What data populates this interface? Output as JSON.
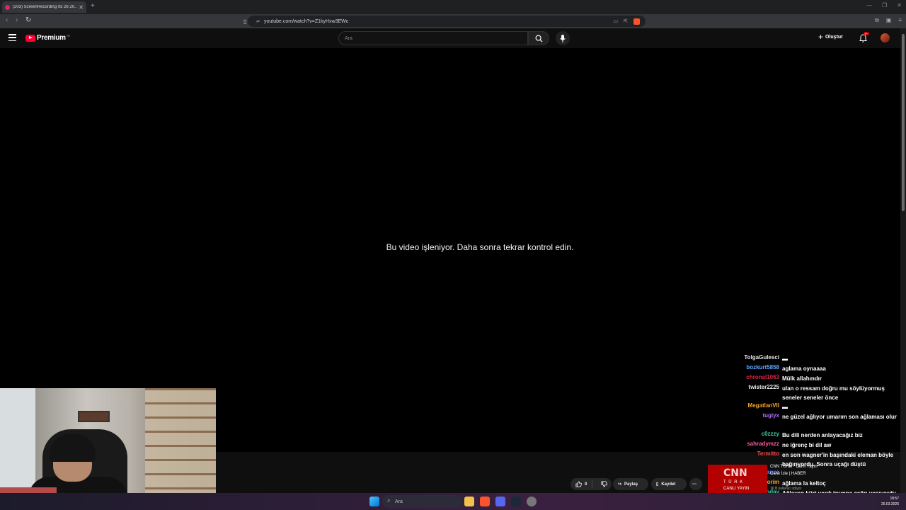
{
  "browser": {
    "tab_title": "(203) ScreenRecording 03 26 20...",
    "url": "youtube.com/watch?v=Z1kyHxw3EWc"
  },
  "youtube": {
    "logo_text": "Premium",
    "logo_region": "TR",
    "search_placeholder": "Ara",
    "create_label": "Oluştur",
    "notification_count": "9+"
  },
  "player": {
    "message": "Bu video işleniyor. Daha sonra tekrar kontrol edin."
  },
  "actions": {
    "like_count": "0",
    "share_label": "Paylaş",
    "save_label": "Kaydet"
  },
  "chat": [
    {
      "user": "TolgaGulesci",
      "message": "▬",
      "color": "#e6e6e6"
    },
    {
      "user": "bozkurt5858",
      "message": "aglama oynaaaa",
      "color": "#5aa9ff"
    },
    {
      "user": "chronal1063",
      "message": "Mülk allahındır",
      "color": "#d6264a"
    },
    {
      "user": "twister2225",
      "message": "ulan o ressam doğru mu söylüyormuş seneler seneler önce",
      "color": "#e6e6e6"
    },
    {
      "user": "MegatlanVII",
      "message": "▬",
      "color": "#f5a623"
    },
    {
      "user": "tugiyx",
      "message": "ne güzel ağlıyor umarım son ağlaması olur",
      "color": "#b56cff"
    },
    {
      "user": "c0zzzy",
      "message": "Bu dili nerden anlayacağız biz",
      "color": "#40d0a0"
    },
    {
      "user": "sahradymzz",
      "message": "ne iğrenç bi dil aw",
      "color": "#ff5aa0"
    },
    {
      "user": "Termitto",
      "message": "en son wagner'in başındaki eleman böyle bağırıyordu. Sonra uçağı düştü",
      "color": "#ff4040"
    },
    {
      "user": "riasaucc",
      "message": "",
      "color": "#5a7bff"
    },
    {
      "user": "Volkanthorim",
      "message": "ağlama la keltoç",
      "color": "#f5a623"
    },
    {
      "user": "noanymoutoday",
      "message": "Ağlayan kürt vardı trumpa çağrı yapıyordu ona benzemiş",
      "color": "#40d0a0"
    }
  ],
  "cnn": {
    "logo": "CNN",
    "sub": "T Ü R K",
    "live": "CANLI YAYIN",
    "line1": "CNN TÜRK · Canlı Yayın",
    "line2": "Canlı İzle | HABER",
    "line3": "16 B kullanıcı izliyor"
  },
  "taskbar": {
    "search_placeholder": "Ara",
    "time": "18:57",
    "date": "26.03.2026"
  }
}
